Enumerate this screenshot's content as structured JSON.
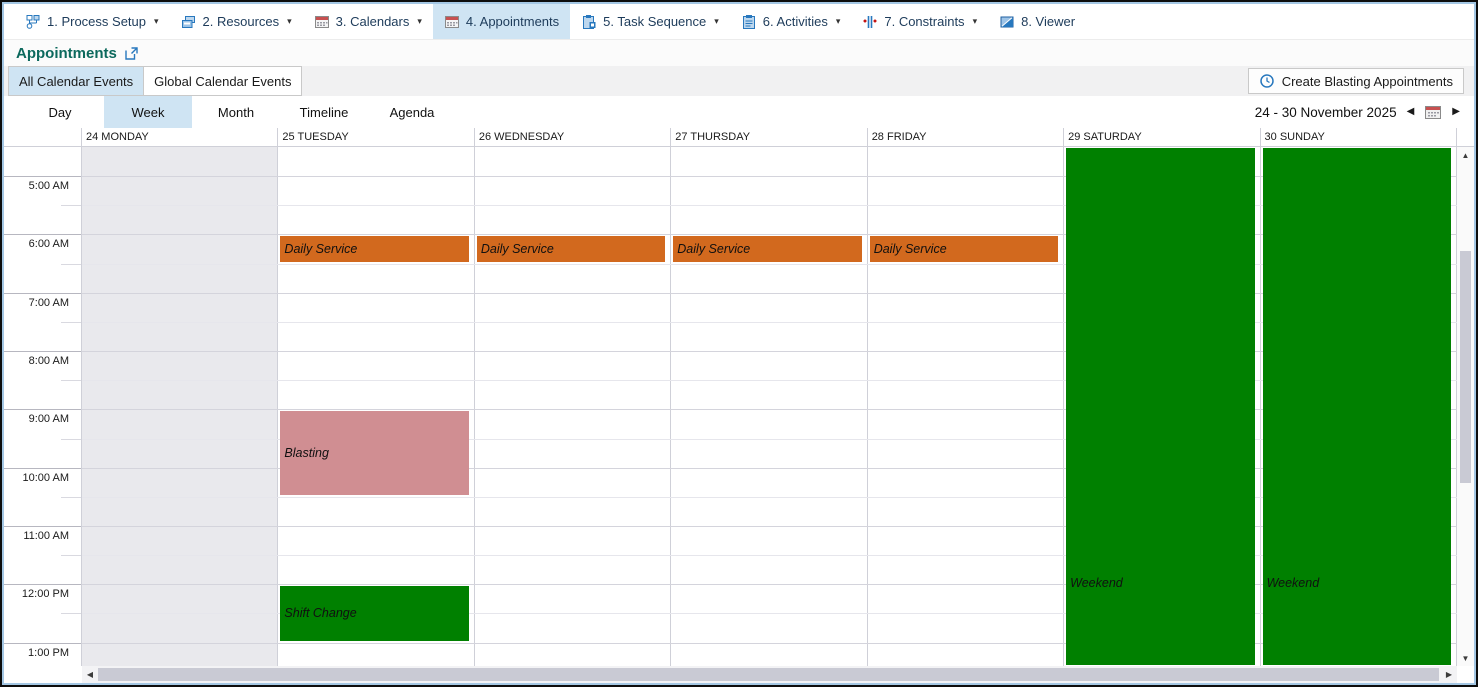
{
  "ribbon": {
    "tabs": [
      {
        "label": "1. Process Setup",
        "icon": "process-setup-icon",
        "dropdown": true,
        "selected": false
      },
      {
        "label": "2. Resources",
        "icon": "resources-icon",
        "dropdown": true,
        "selected": false
      },
      {
        "label": "3. Calendars",
        "icon": "calendars-icon",
        "dropdown": true,
        "selected": false
      },
      {
        "label": "4. Appointments",
        "icon": "appointments-icon",
        "dropdown": false,
        "selected": true
      },
      {
        "label": "5. Task Sequence",
        "icon": "task-sequence-icon",
        "dropdown": true,
        "selected": false
      },
      {
        "label": "6. Activities",
        "icon": "activities-icon",
        "dropdown": true,
        "selected": false
      },
      {
        "label": "7. Constraints",
        "icon": "constraints-icon",
        "dropdown": true,
        "selected": false
      },
      {
        "label": "8. Viewer",
        "icon": "viewer-icon",
        "dropdown": false,
        "selected": false
      }
    ]
  },
  "page": {
    "title": "Appointments"
  },
  "filter_tabs": [
    {
      "label": "All Calendar Events",
      "selected": true
    },
    {
      "label": "Global Calendar Events",
      "selected": false
    }
  ],
  "toolbar": {
    "create_button_label": "Create Blasting Appointments"
  },
  "view_tabs": [
    {
      "label": "Day",
      "selected": false
    },
    {
      "label": "Week",
      "selected": true
    },
    {
      "label": "Month",
      "selected": false
    },
    {
      "label": "Timeline",
      "selected": false
    },
    {
      "label": "Agenda",
      "selected": false
    }
  ],
  "date_nav": {
    "range": "24  - 30 November 2025"
  },
  "calendar": {
    "day_headers": [
      {
        "label": "24 MONDAY",
        "shaded": true
      },
      {
        "label": "25 TUESDAY",
        "shaded": false
      },
      {
        "label": "26 WEDNESDAY",
        "shaded": false
      },
      {
        "label": "27 THURSDAY",
        "shaded": false
      },
      {
        "label": "28 FRIDAY",
        "shaded": false
      },
      {
        "label": "29 SATURDAY",
        "shaded": false
      },
      {
        "label": "30 SUNDAY",
        "shaded": false
      }
    ],
    "time_labels": [
      "5:00 AM",
      "6:00 AM",
      "7:00 AM",
      "8:00 AM",
      "9:00 AM",
      "10:00 AM",
      "11:00 AM",
      "12:00 PM",
      "1:00 PM"
    ],
    "visible_start": "4:30 AM",
    "events": [
      {
        "title": "Daily Service",
        "day": 1,
        "start": "6:00 AM",
        "end": "6:30 AM",
        "color": "#d2691e",
        "all_day": false
      },
      {
        "title": "Daily Service",
        "day": 2,
        "start": "6:00 AM",
        "end": "6:30 AM",
        "color": "#d2691e",
        "all_day": false
      },
      {
        "title": "Daily Service",
        "day": 3,
        "start": "6:00 AM",
        "end": "6:30 AM",
        "color": "#d2691e",
        "all_day": false
      },
      {
        "title": "Daily Service",
        "day": 4,
        "start": "6:00 AM",
        "end": "6:30 AM",
        "color": "#d2691e",
        "all_day": false
      },
      {
        "title": "Blasting",
        "day": 1,
        "start": "9:00 AM",
        "end": "10:30 AM",
        "color": "#d08e92",
        "all_day": false
      },
      {
        "title": "Shift Change",
        "day": 1,
        "start": "12:00 PM",
        "end": "1:00 PM",
        "color": "#008000",
        "all_day": false
      },
      {
        "title": "Weekend",
        "day": 5,
        "color": "#008000",
        "all_day": true
      },
      {
        "title": "Weekend",
        "day": 6,
        "color": "#008000",
        "all_day": true
      }
    ]
  },
  "colors": {
    "selection_highlight": "#cfe4f3",
    "monday_shade": "#e9e9ed",
    "page_title": "#0c695d",
    "accent_blue": "#2878be",
    "event_daily_service": "#d2691e",
    "event_blasting": "#d08e92",
    "event_green": "#008000"
  }
}
